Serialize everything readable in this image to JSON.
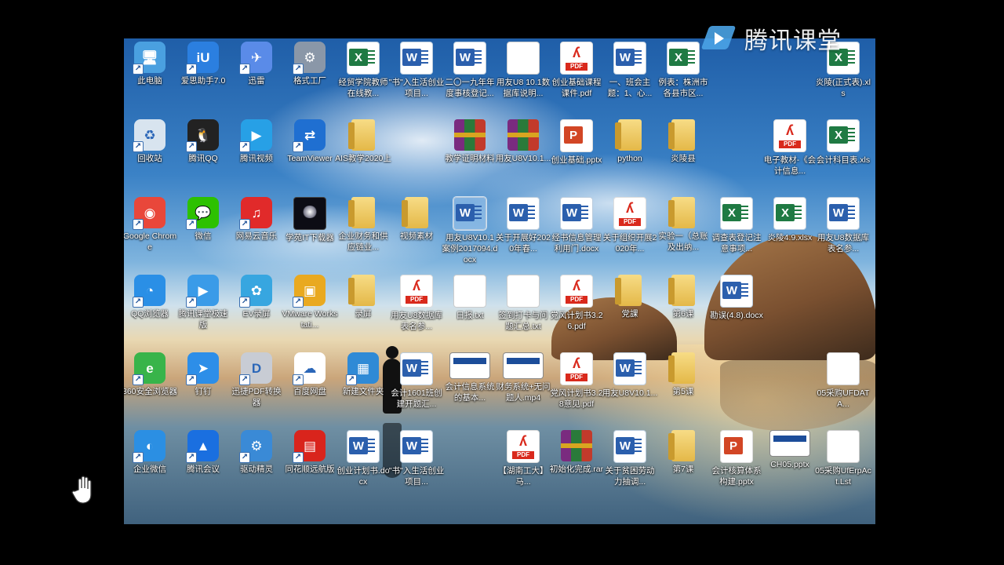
{
  "brand": {
    "text": "腾讯课堂"
  },
  "desktop": {
    "icons": [
      {
        "label": "此电脑",
        "type": "app",
        "color": "#4aa0e0",
        "glyph": "🖥"
      },
      {
        "label": "爱思助手7.0",
        "type": "app",
        "color": "#2b7fe0",
        "glyph": "iU"
      },
      {
        "label": "迅雷",
        "type": "app",
        "color": "#5a8be8",
        "glyph": "✈"
      },
      {
        "label": "格式工厂",
        "type": "app",
        "color": "#8a97a8",
        "glyph": "⚙"
      },
      {
        "label": "经贸学院教师在线教...",
        "type": "excel"
      },
      {
        "label": "\"书\"入生活创业项目...",
        "type": "word"
      },
      {
        "label": "二〇一九年年度事核登记...",
        "type": "word"
      },
      {
        "label": "用友U8 10.1数据库说明...",
        "type": "blank"
      },
      {
        "label": "创业基础课程课件.pdf",
        "type": "pdf"
      },
      {
        "label": "一、班会主题：1、心...",
        "type": "word"
      },
      {
        "label": "例表：株洲市各县市区...",
        "type": "excel"
      },
      {
        "label": "",
        "type": "none"
      },
      {
        "label": "",
        "type": "none"
      },
      {
        "label": "炎陵(正式表).xls",
        "type": "excel"
      },
      {
        "label": "回收站",
        "type": "app",
        "color": "#d8e4ef",
        "glyph": "♻"
      },
      {
        "label": "腾讯QQ",
        "type": "app",
        "color": "#222",
        "glyph": "🐧"
      },
      {
        "label": "腾讯视频",
        "type": "app",
        "color": "#27a0e6",
        "glyph": "▶"
      },
      {
        "label": "TeamViewer",
        "type": "app",
        "color": "#1f6fd1",
        "glyph": "⇄"
      },
      {
        "label": "AIS教学2020上",
        "type": "folder"
      },
      {
        "label": "",
        "type": "none"
      },
      {
        "label": "教学证明材料",
        "type": "rar"
      },
      {
        "label": "用友U8V10.1...",
        "type": "rar"
      },
      {
        "label": "创业基础.pptx",
        "type": "ppt"
      },
      {
        "label": "python",
        "type": "folder"
      },
      {
        "label": "炎陵县",
        "type": "folder"
      },
      {
        "label": "",
        "type": "none"
      },
      {
        "label": "电子教材-《会计信息...",
        "type": "pdf"
      },
      {
        "label": "会计科目表.xls",
        "type": "excel"
      },
      {
        "label": "Google Chrome",
        "type": "app",
        "color": "#e9473a",
        "glyph": "◉"
      },
      {
        "label": "微信",
        "type": "app",
        "color": "#2dc100",
        "glyph": "💬"
      },
      {
        "label": "网易云音乐",
        "type": "app",
        "color": "#e12a2a",
        "glyph": "♫"
      },
      {
        "label": "学苑IT下载器",
        "type": "img"
      },
      {
        "label": "企业财务和供应链业...",
        "type": "folder"
      },
      {
        "label": "视频素材",
        "type": "folder"
      },
      {
        "label": "用友U8V10.1案例2017094.docx",
        "type": "word",
        "selected": true
      },
      {
        "label": "关于开展好2020年春...",
        "type": "word"
      },
      {
        "label": "经书信息管理利用门.docx",
        "type": "word"
      },
      {
        "label": "关于组织开展2020年...",
        "type": "pdf"
      },
      {
        "label": "实验一（总账及出纳...",
        "type": "folder"
      },
      {
        "label": "调查表登记注意事项...",
        "type": "excel"
      },
      {
        "label": "炎陵4.9.xlsx",
        "type": "excel"
      },
      {
        "label": "用友U8数据库表名参...",
        "type": "word"
      },
      {
        "label": "QQ浏览器",
        "type": "app",
        "color": "#2a8fe6",
        "glyph": "◔"
      },
      {
        "label": "腾讯课堂极速版",
        "type": "app",
        "color": "#3a9be8",
        "glyph": "▶"
      },
      {
        "label": "EV录屏",
        "type": "app",
        "color": "#37a6e0",
        "glyph": "✿"
      },
      {
        "label": "VMware Workstati...",
        "type": "app",
        "color": "#e9a920",
        "glyph": "▣"
      },
      {
        "label": "录屏",
        "type": "folder"
      },
      {
        "label": "用友U8数据库表名参...",
        "type": "pdf"
      },
      {
        "label": "日报.txt",
        "type": "blank"
      },
      {
        "label": "签到打卡与问题汇总.txt",
        "type": "blank"
      },
      {
        "label": "党风计划书3.26.pdf",
        "type": "pdf"
      },
      {
        "label": "党課",
        "type": "folder"
      },
      {
        "label": "第6课",
        "type": "folder"
      },
      {
        "label": "勘误(4.8).docx",
        "type": "word"
      },
      {
        "label": "",
        "type": "none"
      },
      {
        "label": "",
        "type": "none"
      },
      {
        "label": "360安全浏览器",
        "type": "app",
        "color": "#38b44a",
        "glyph": "e"
      },
      {
        "label": "钉钉",
        "type": "app",
        "color": "#2d8ee8",
        "glyph": "➤"
      },
      {
        "label": "迅捷PDF转换器",
        "type": "app",
        "color": "#c8ccd4",
        "glyph": "D"
      },
      {
        "label": "百度网盘",
        "type": "app",
        "color": "#fff",
        "glyph": "☁"
      },
      {
        "label": "新建文件夹",
        "type": "app",
        "color": "#2f8ad6",
        "glyph": "▦"
      },
      {
        "label": "会计1601班创建开题汇...",
        "type": "word"
      },
      {
        "label": "会计信息系统的基本...",
        "type": "slide"
      },
      {
        "label": "财务系统+无问题人.mp4",
        "type": "slide"
      },
      {
        "label": "党风计划书3.28意见.pdf",
        "type": "pdf"
      },
      {
        "label": "用友U8V10.1...",
        "type": "word"
      },
      {
        "label": "第5课",
        "type": "folder"
      },
      {
        "label": "",
        "type": "none"
      },
      {
        "label": "",
        "type": "none"
      },
      {
        "label": "05采购UFDATA...",
        "type": "blank"
      },
      {
        "label": "企业微信",
        "type": "app",
        "color": "#2b8fe3",
        "glyph": "◐"
      },
      {
        "label": "腾讯会议",
        "type": "app",
        "color": "#1a6fe0",
        "glyph": "▲"
      },
      {
        "label": "驱动精灵",
        "type": "app",
        "color": "#3a8ad6",
        "glyph": "⚙"
      },
      {
        "label": "同花顺远航版",
        "type": "app",
        "color": "#d9241c",
        "glyph": "▤"
      },
      {
        "label": "创业计划书.docx",
        "type": "word"
      },
      {
        "label": "\"书\"入生活创业项目...",
        "type": "word"
      },
      {
        "label": "",
        "type": "none"
      },
      {
        "label": "【湖南工大】马...",
        "type": "pdf"
      },
      {
        "label": "初始化完成.rar",
        "type": "rar"
      },
      {
        "label": "关于贫困劳动力抽调...",
        "type": "word"
      },
      {
        "label": "第7课",
        "type": "folder"
      },
      {
        "label": "会计核算体系构建.pptx",
        "type": "ppt"
      },
      {
        "label": "CH05.pptx",
        "type": "slide"
      },
      {
        "label": "05采购UfErpAct.Lst",
        "type": "blank"
      }
    ]
  }
}
